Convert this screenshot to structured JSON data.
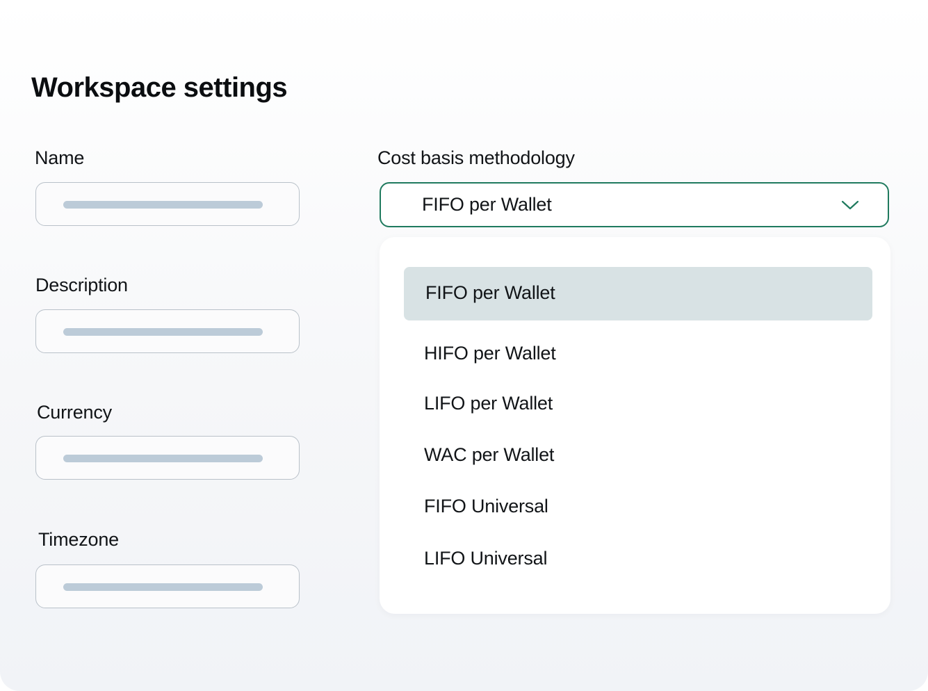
{
  "page": {
    "title": "Workspace settings"
  },
  "form": {
    "name_label": "Name",
    "description_label": "Description",
    "currency_label": "Currency",
    "timezone_label": "Timezone"
  },
  "cost_basis": {
    "label": "Cost basis methodology",
    "selected_value": "FIFO per Wallet",
    "chevron_icon": "chevron-down-icon",
    "options": [
      {
        "label": "FIFO per Wallet",
        "selected": true
      },
      {
        "label": "HIFO per Wallet",
        "selected": false
      },
      {
        "label": "LIFO per Wallet",
        "selected": false
      },
      {
        "label": "WAC per Wallet",
        "selected": false
      },
      {
        "label": "FIFO Universal",
        "selected": false
      },
      {
        "label": "LIFO Universal",
        "selected": false
      }
    ]
  },
  "colors": {
    "accent": "#1f7a5e",
    "selected_option_bg": "#d8e2e4",
    "placeholder_bar": "#bccbd8",
    "field_border": "#b9c1c9"
  }
}
